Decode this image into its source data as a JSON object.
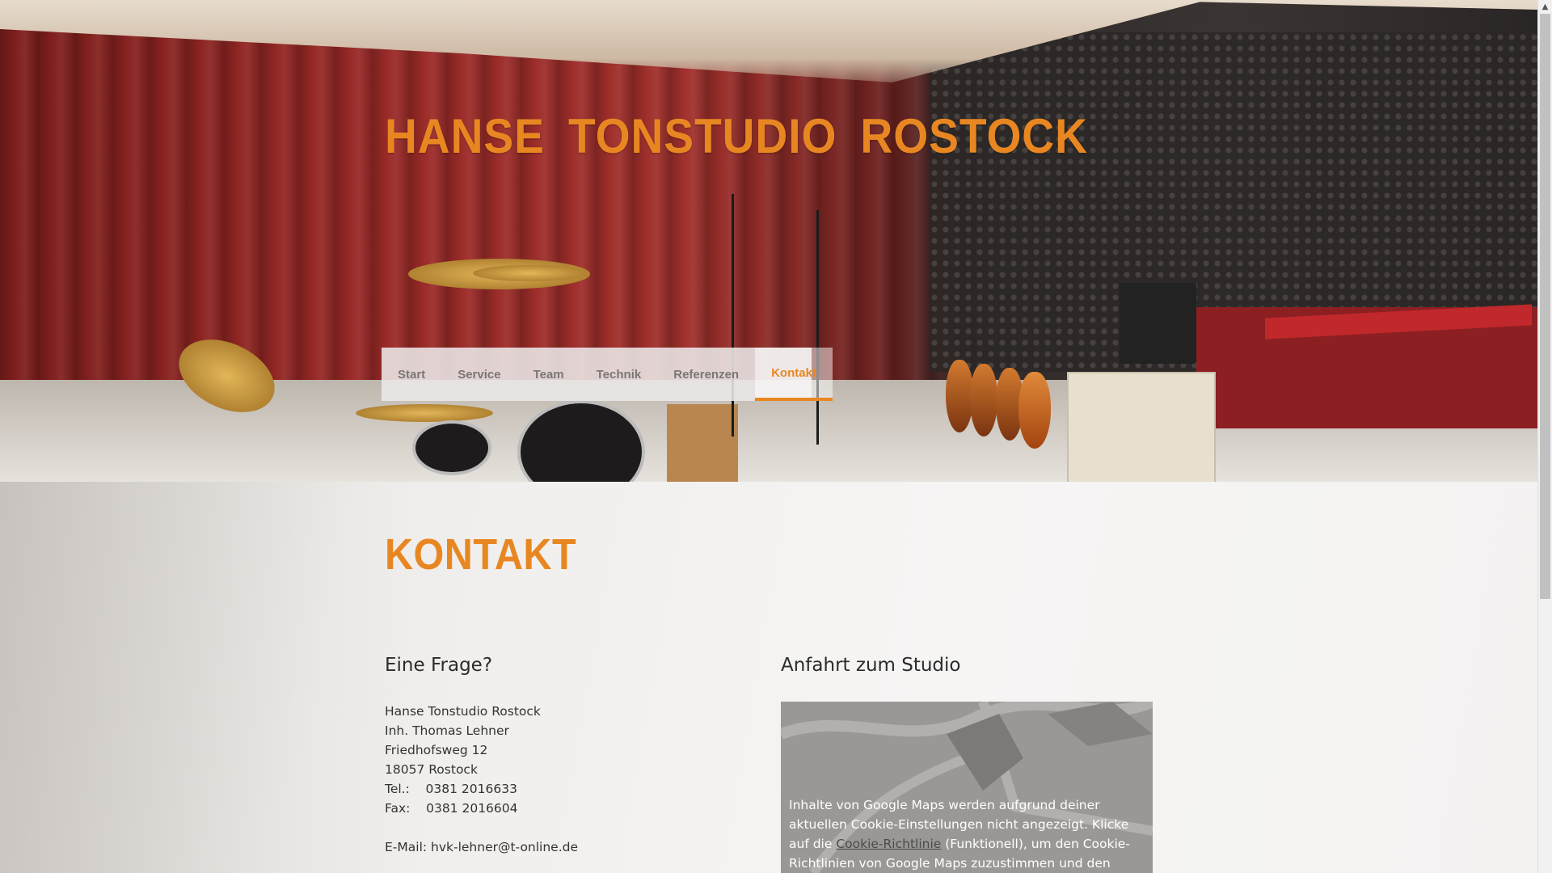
{
  "site": {
    "title": "HANSE TONSTUDIO ROSTOCK"
  },
  "nav": {
    "items": [
      {
        "label": "Start"
      },
      {
        "label": "Service"
      },
      {
        "label": "Team"
      },
      {
        "label": "Technik"
      },
      {
        "label": "Referenzen"
      },
      {
        "label": "Kontakt",
        "active": true
      }
    ]
  },
  "page": {
    "heading": "KONTAKT"
  },
  "contact": {
    "title": "Eine Frage?",
    "lines": [
      "Hanse Tonstudio Rostock",
      "Inh. Thomas Lehner",
      "Friedhofsweg 12",
      "18057 Rostock",
      "Tel.:    0381 2016633",
      "Fax:    0381 2016604"
    ],
    "email": "E-Mail: hvk-lehner@t-online.de"
  },
  "directions": {
    "title": "Anfahrt zum Studio",
    "notice_before": "Inhalte von Google Maps werden aufgrund deiner aktuellen Cookie-Einstellungen nicht angezeigt. Klicke auf die ",
    "notice_link": "Cookie-Richtlinie",
    "notice_after": " (Funktionell), um den Cookie-Richtlinien von Google Maps zuzustimmen und den Inhalt anzusehen. Mehr dazu"
  },
  "colors": {
    "accent": "#e88722",
    "text": "#2b2b2b"
  },
  "icons": {
    "scroll_up": "scroll-up-arrow-icon"
  }
}
